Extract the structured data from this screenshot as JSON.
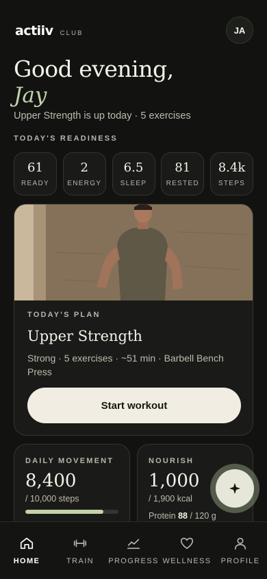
{
  "header": {
    "brand": "actiiv",
    "brand_sub": "CLUB",
    "avatar_initials": "JA"
  },
  "greeting": {
    "line1": "Good evening,",
    "name": "Jay",
    "subtitle": "Upper Strength is up today · 5 exercises"
  },
  "readiness": {
    "label": "TODAY'S READINESS",
    "metrics": [
      {
        "value": "61",
        "label": "READY"
      },
      {
        "value": "2",
        "label": "ENERGY"
      },
      {
        "value": "6.5",
        "label": "SLEEP"
      },
      {
        "value": "81",
        "label": "RESTED"
      },
      {
        "value": "8.4k",
        "label": "STEPS"
      }
    ]
  },
  "plan": {
    "eyebrow": "TODAY'S PLAN",
    "title": "Upper Strength",
    "meta": "Strong · 5 exercises · ~51 min · Barbell Bench Press",
    "cta": "Start workout"
  },
  "movement": {
    "eyebrow": "DAILY MOVEMENT",
    "value": "8,400",
    "sub": "/ 10,000 steps",
    "progress": 0.84
  },
  "nourish": {
    "eyebrow": "NOURISH",
    "value": "1,000",
    "sub": "/ 1,900 kcal",
    "protein_label": "Protein",
    "protein_value": "88",
    "protein_target": "/ 120 g"
  },
  "tabs": [
    {
      "label": "HOME",
      "icon": "home-icon",
      "active": true
    },
    {
      "label": "TRAIN",
      "icon": "dumbbell-icon",
      "active": false
    },
    {
      "label": "PROGRESS",
      "icon": "chart-line-icon",
      "active": false
    },
    {
      "label": "WELLNESS",
      "icon": "heart-icon",
      "active": false
    },
    {
      "label": "PROFILE",
      "icon": "user-icon",
      "active": false
    }
  ],
  "colors": {
    "background": "#121311",
    "accent": "#c3d3ac",
    "card": "#1a1b18",
    "button": "#f2ede2"
  }
}
